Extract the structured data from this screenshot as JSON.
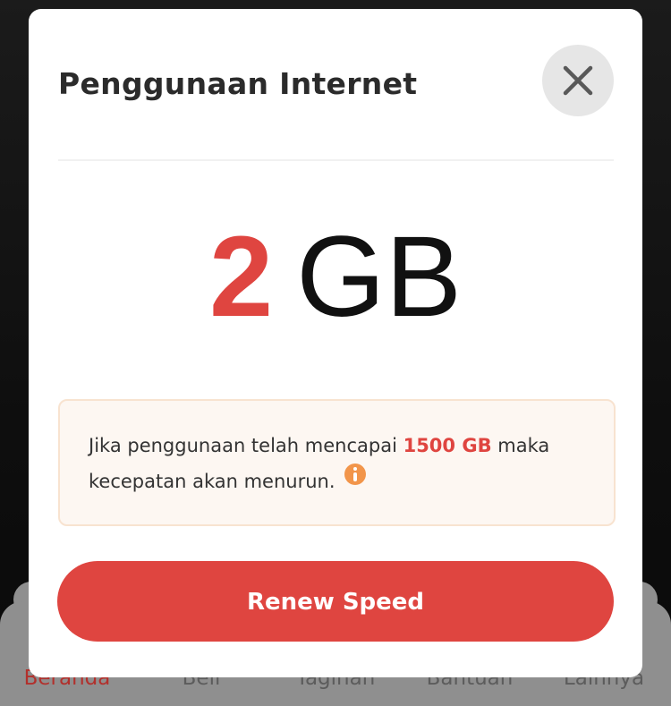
{
  "background": {
    "bottom_nav": [
      {
        "label": "Beranda",
        "active": true
      },
      {
        "label": "Beli",
        "active": false
      },
      {
        "label": "Tagihan",
        "active": false
      },
      {
        "label": "Bantuan",
        "active": false
      },
      {
        "label": "Lainnya",
        "active": false
      }
    ]
  },
  "modal": {
    "title": "Penggunaan Internet",
    "close_icon": "close-icon",
    "usage": {
      "value": "2",
      "unit": "GB"
    },
    "notice": {
      "text_before": "Jika penggunaan telah mencapai ",
      "highlight": "1500 GB",
      "text_after": " maka kecepatan akan menurun.",
      "icon": "info-icon"
    },
    "action_label": "Renew Speed"
  },
  "colors": {
    "accent": "#df4540",
    "info_icon": "#f2954a",
    "notice_bg": "#fdf7f2"
  }
}
